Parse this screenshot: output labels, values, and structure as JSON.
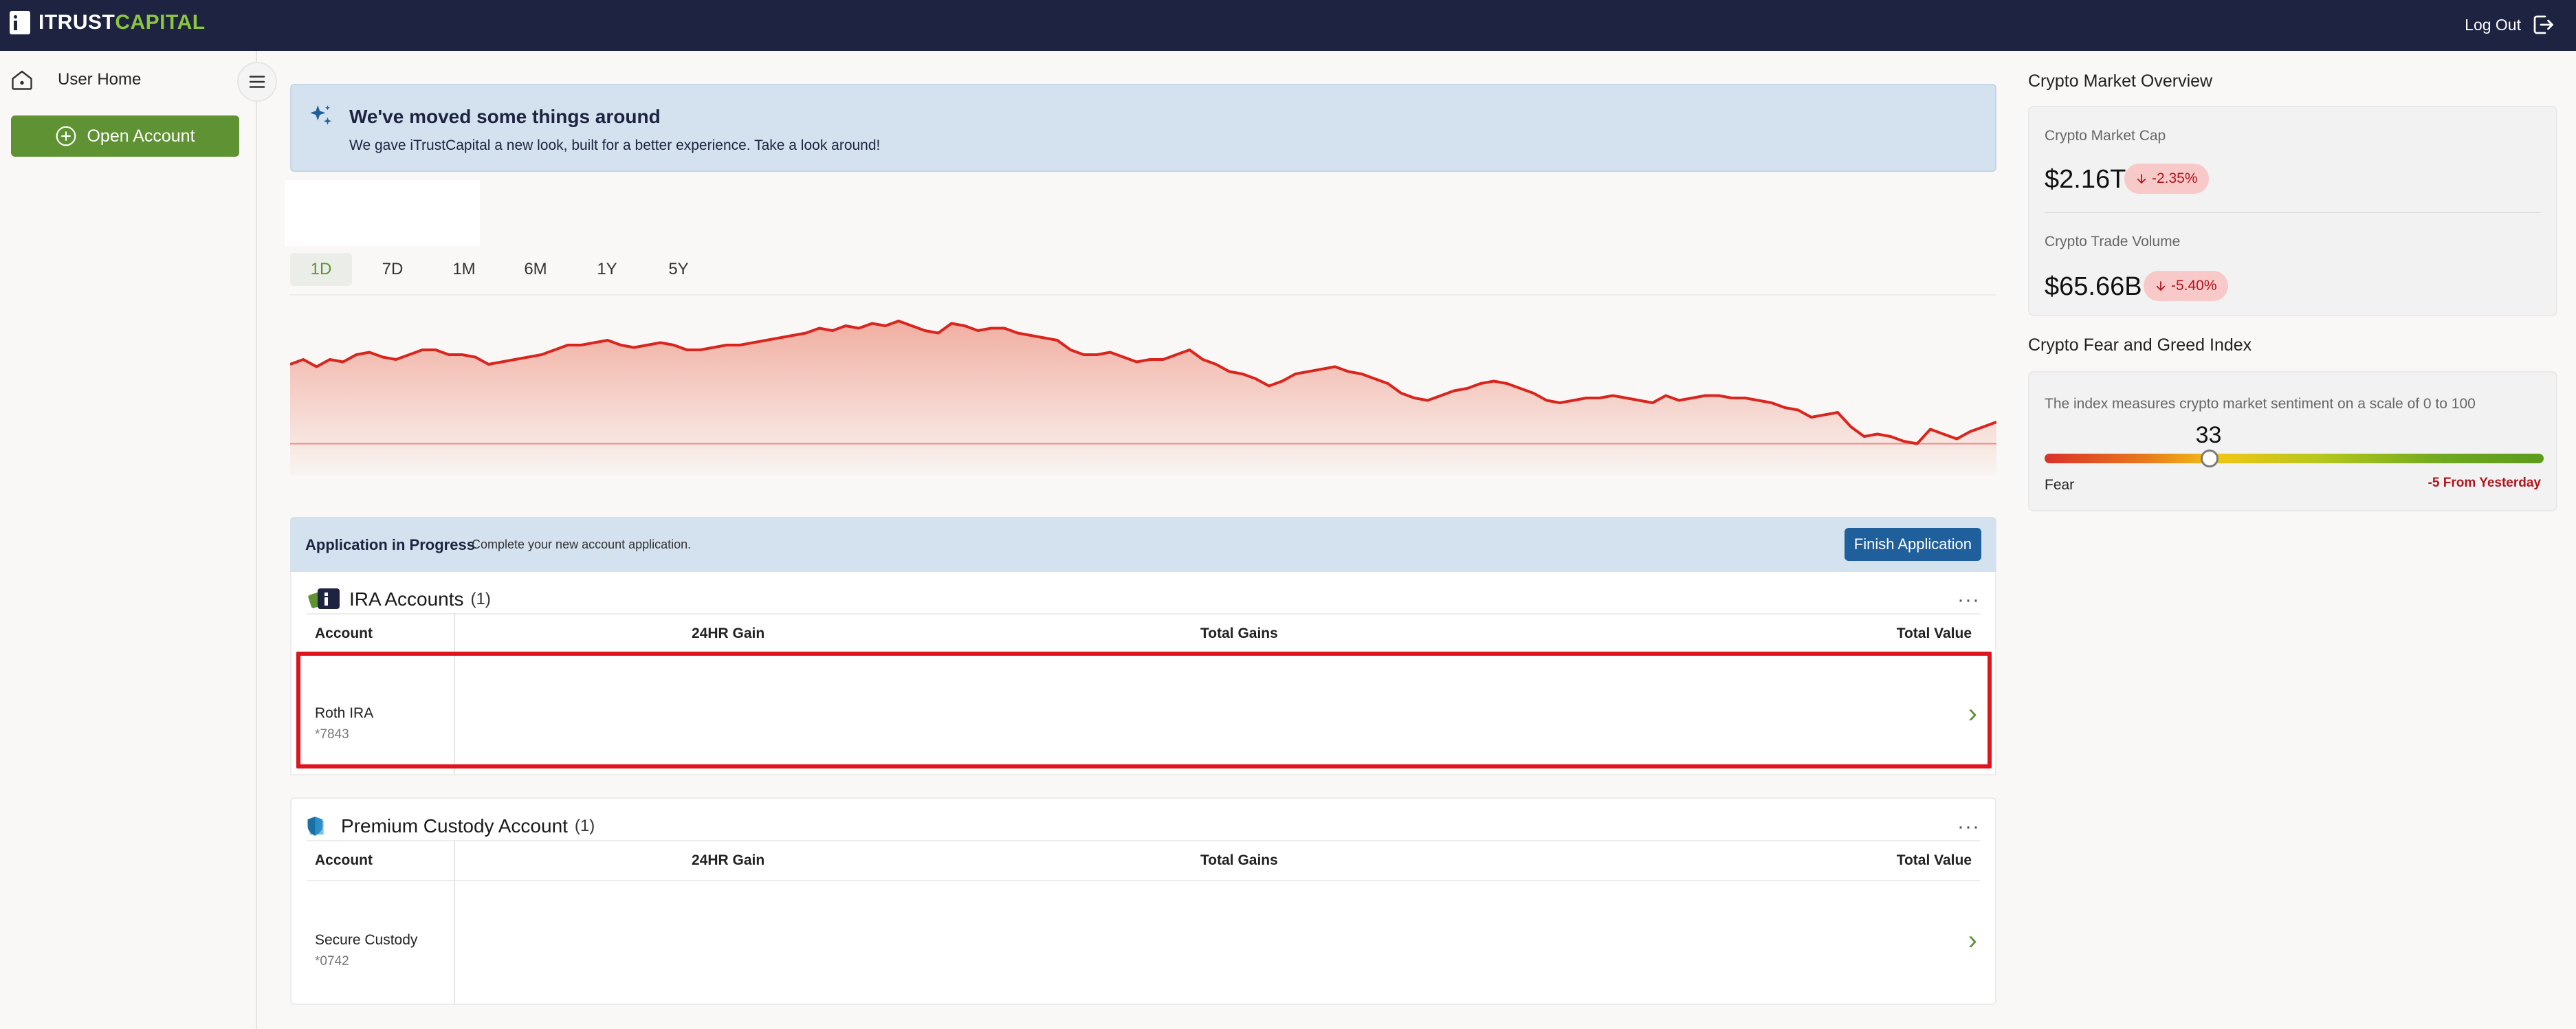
{
  "topbar": {
    "logo_part1": "ITRUST",
    "logo_part2": "CAPITAL",
    "logout_label": "Log Out"
  },
  "sidebar": {
    "home_label": "User Home",
    "open_account_label": "Open Account"
  },
  "banner": {
    "title": "We've moved some things around",
    "text": "We gave iTrustCapital a new look, built for a better experience. Take a look around!"
  },
  "ranges": [
    "1D",
    "7D",
    "1M",
    "6M",
    "1Y",
    "5Y"
  ],
  "active_range": "1D",
  "chart_data": {
    "type": "area",
    "title": "",
    "xlabel": "",
    "ylabel": "",
    "color": "#d9251d",
    "values": [
      60,
      62,
      59,
      62,
      61,
      64,
      65,
      63,
      62,
      64,
      66,
      66,
      64,
      64,
      63,
      60,
      61,
      62,
      63,
      64,
      66,
      68,
      68,
      69,
      70,
      68,
      67,
      68,
      69,
      68,
      66,
      66,
      67,
      68,
      68,
      69,
      70,
      71,
      72,
      73,
      75,
      74,
      76,
      75,
      77,
      76,
      78,
      76,
      74,
      73,
      77,
      76,
      74,
      75,
      75,
      73,
      72,
      71,
      70,
      66,
      64,
      64,
      65,
      63,
      61,
      62,
      62,
      64,
      66,
      62,
      60,
      57,
      56,
      54,
      51,
      53,
      56,
      57,
      58,
      59,
      57,
      56,
      54,
      52,
      48,
      46,
      45,
      47,
      49,
      50,
      52,
      53,
      52,
      50,
      48,
      45,
      44,
      45,
      46,
      46,
      47,
      46,
      45,
      44,
      47,
      45,
      46,
      47,
      47,
      46,
      46,
      45,
      44,
      42,
      41,
      38,
      39,
      40,
      34,
      30,
      31,
      30,
      28,
      27,
      33,
      31,
      29,
      32,
      34,
      36
    ],
    "baseline": 27
  },
  "application": {
    "title": "Application in Progress",
    "description": "Complete your new account application.",
    "button": "Finish Application"
  },
  "ira": {
    "title": "IRA Accounts",
    "count": "(1)",
    "more": "···",
    "columns": [
      "Account",
      "24HR Gain",
      "Total Gains",
      "Total Value"
    ],
    "row": {
      "name": "Roth IRA",
      "number": "*7843",
      "chevron": "›"
    }
  },
  "premium": {
    "title": "Premium Custody Account",
    "count": "(1)",
    "more": "···",
    "columns": [
      "Account",
      "24HR Gain",
      "Total Gains",
      "Total Value"
    ],
    "row": {
      "name": "Secure Custody",
      "number": "*0742",
      "chevron": "›"
    }
  },
  "market": {
    "title": "Crypto Market Overview",
    "cap_label": "Crypto Market Cap",
    "cap_value": "$2.16T",
    "cap_change": "-2.35%",
    "volume_label": "Crypto Trade Volume",
    "volume_value": "$65.66B",
    "volume_change": "-5.40%"
  },
  "fear_greed": {
    "title": "Crypto Fear and Greed Index",
    "description": "The index measures crypto market sentiment on a scale of 0 to 100",
    "value": "33",
    "level": 33,
    "sentiment": "Fear",
    "change": "-5 From Yesterday"
  },
  "colors": {
    "topbar": "#1d2340",
    "accent_green": "#5e9232",
    "negative": "#b3141b",
    "highlight": "#e0141e"
  }
}
